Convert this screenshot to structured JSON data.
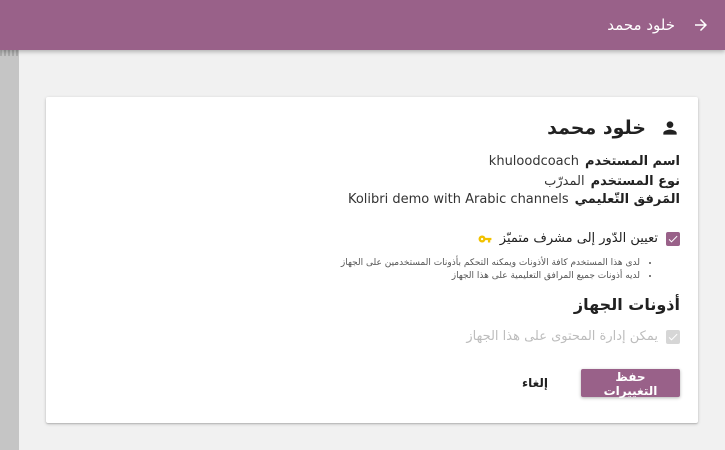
{
  "appbar": {
    "title": "خلود محمد",
    "back_icon": "arrow-forward-icon"
  },
  "user": {
    "full_name": "خلود محمد",
    "icon": "person-icon"
  },
  "details": {
    "username_label": "اسم المستخدم",
    "username_value": "khuloodcoach",
    "user_type_label": "نوع المستخدم",
    "user_type_value": "المدرّب",
    "facility_label": "المَرفق التّعليمي",
    "facility_value": "Kolibri demo with Arabic channels"
  },
  "super_admin": {
    "label": "تعيين الدّور إلى مشرف متميّز",
    "checked": true,
    "key_icon": "key-icon",
    "bullets": [
      "لدى هذا المستخدم كافة الأذونات ويمكنه التحكم بأذونات المستخدمين على الجهاز",
      "لديه أذونات جميع المرافق التعليمية على هذا الجهاز"
    ]
  },
  "device_permissions": {
    "title": "أذونات الجهاز",
    "manage_content_label": "يمكن إدارة المحتوى على هذا الجهاز",
    "manage_content_checked": true,
    "manage_content_disabled": true
  },
  "actions": {
    "save_label": "حفظ التغييرات",
    "cancel_label": "إلغاء"
  },
  "colors": {
    "brand": "#996189",
    "background": "#f1f1f1",
    "key_icon": "#f2c200"
  }
}
